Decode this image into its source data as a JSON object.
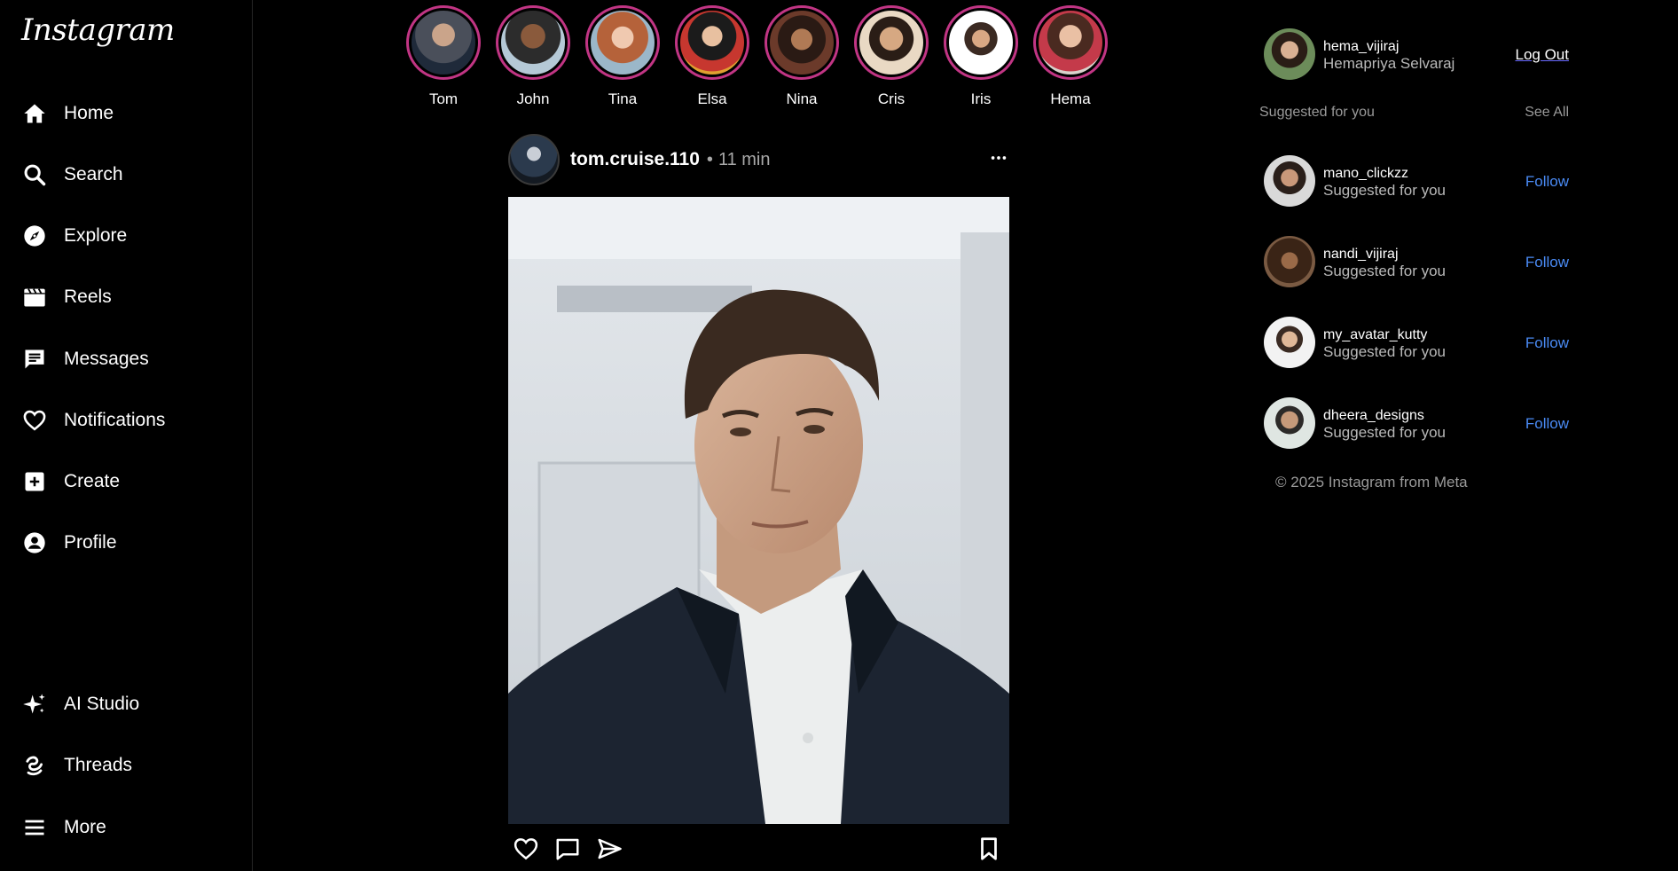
{
  "brand": {
    "logo_text": "Instagram"
  },
  "sidebar": {
    "items": [
      {
        "label": "Home",
        "icon": "home-icon"
      },
      {
        "label": "Search",
        "icon": "search-icon"
      },
      {
        "label": "Explore",
        "icon": "compass-icon"
      },
      {
        "label": "Reels",
        "icon": "reels-icon"
      },
      {
        "label": "Messages",
        "icon": "messages-icon"
      },
      {
        "label": "Notifications",
        "icon": "heart-icon"
      },
      {
        "label": "Create",
        "icon": "plus-square-icon"
      },
      {
        "label": "Profile",
        "icon": "profile-icon"
      }
    ],
    "bottom_items": [
      {
        "label": "AI Studio",
        "icon": "sparkle-icon"
      },
      {
        "label": "Threads",
        "icon": "threads-icon"
      },
      {
        "label": "More",
        "icon": "menu-icon"
      }
    ]
  },
  "stories": [
    {
      "name": "Tom"
    },
    {
      "name": "John"
    },
    {
      "name": "Tina"
    },
    {
      "name": "Elsa"
    },
    {
      "name": "Nina"
    },
    {
      "name": "Cris"
    },
    {
      "name": "Iris"
    },
    {
      "name": "Hema"
    }
  ],
  "post": {
    "username": "tom.cruise.110",
    "separator": "•",
    "time": "11 min"
  },
  "current_user": {
    "username": "hema_vijiraj",
    "full_name": "Hemapriya Selvaraj",
    "logout_label": "Log Out"
  },
  "suggestions": {
    "heading": "Suggested for you",
    "see_all": "See All",
    "users": [
      {
        "username": "mano_clickzz",
        "subtitle": "Suggested for you",
        "action": "Follow"
      },
      {
        "username": "nandi_vijiraj",
        "subtitle": "Suggested for you",
        "action": "Follow"
      },
      {
        "username": "my_avatar_kutty",
        "subtitle": "Suggested for you",
        "action": "Follow"
      },
      {
        "username": "dheera_designs",
        "subtitle": "Suggested for you",
        "action": "Follow"
      }
    ]
  },
  "footer": {
    "copyright": "© 2025 Instagram from Meta"
  },
  "colors": {
    "background": "#000000",
    "story_ring": "#c13584",
    "follow_link": "#4a8bf5",
    "muted_text": "#9a9a9a"
  }
}
